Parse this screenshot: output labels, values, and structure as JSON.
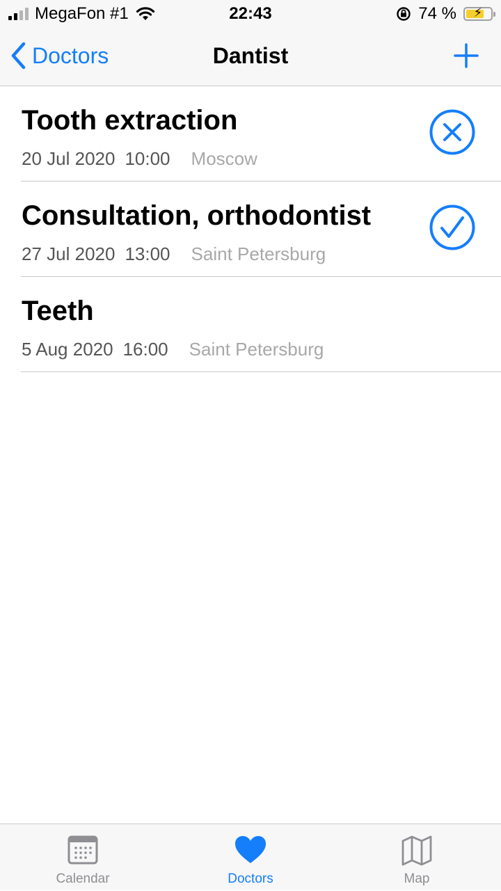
{
  "status_bar": {
    "carrier": "MegaFon #1",
    "time": "22:43",
    "battery_percent": "74 %",
    "battery_level": 0.74
  },
  "nav": {
    "back_label": "Doctors",
    "title": "Dantist"
  },
  "appointments": [
    {
      "title": "Tooth extraction",
      "date": "20 Jul 2020",
      "time": "10:00",
      "city": "Moscow",
      "status_icon": "cancel-circle-icon"
    },
    {
      "title": "Consultation, orthodontist",
      "date": "27 Jul 2020",
      "time": "13:00",
      "city": "Saint Petersburg",
      "status_icon": "check-circle-icon"
    },
    {
      "title": "Teeth",
      "date": "5 Aug 2020",
      "time": "16:00",
      "city": "Saint Petersburg",
      "status_icon": ""
    }
  ],
  "tabs": [
    {
      "label": "Calendar",
      "icon": "calendar-icon",
      "active": false
    },
    {
      "label": "Doctors",
      "icon": "heart-icon",
      "active": true
    },
    {
      "label": "Map",
      "icon": "map-icon",
      "active": false
    }
  ],
  "colors": {
    "accent": "#147efb",
    "inactive": "#8e8e93",
    "secondary_text": "#555555",
    "tertiary_text": "#a8a8a8"
  }
}
